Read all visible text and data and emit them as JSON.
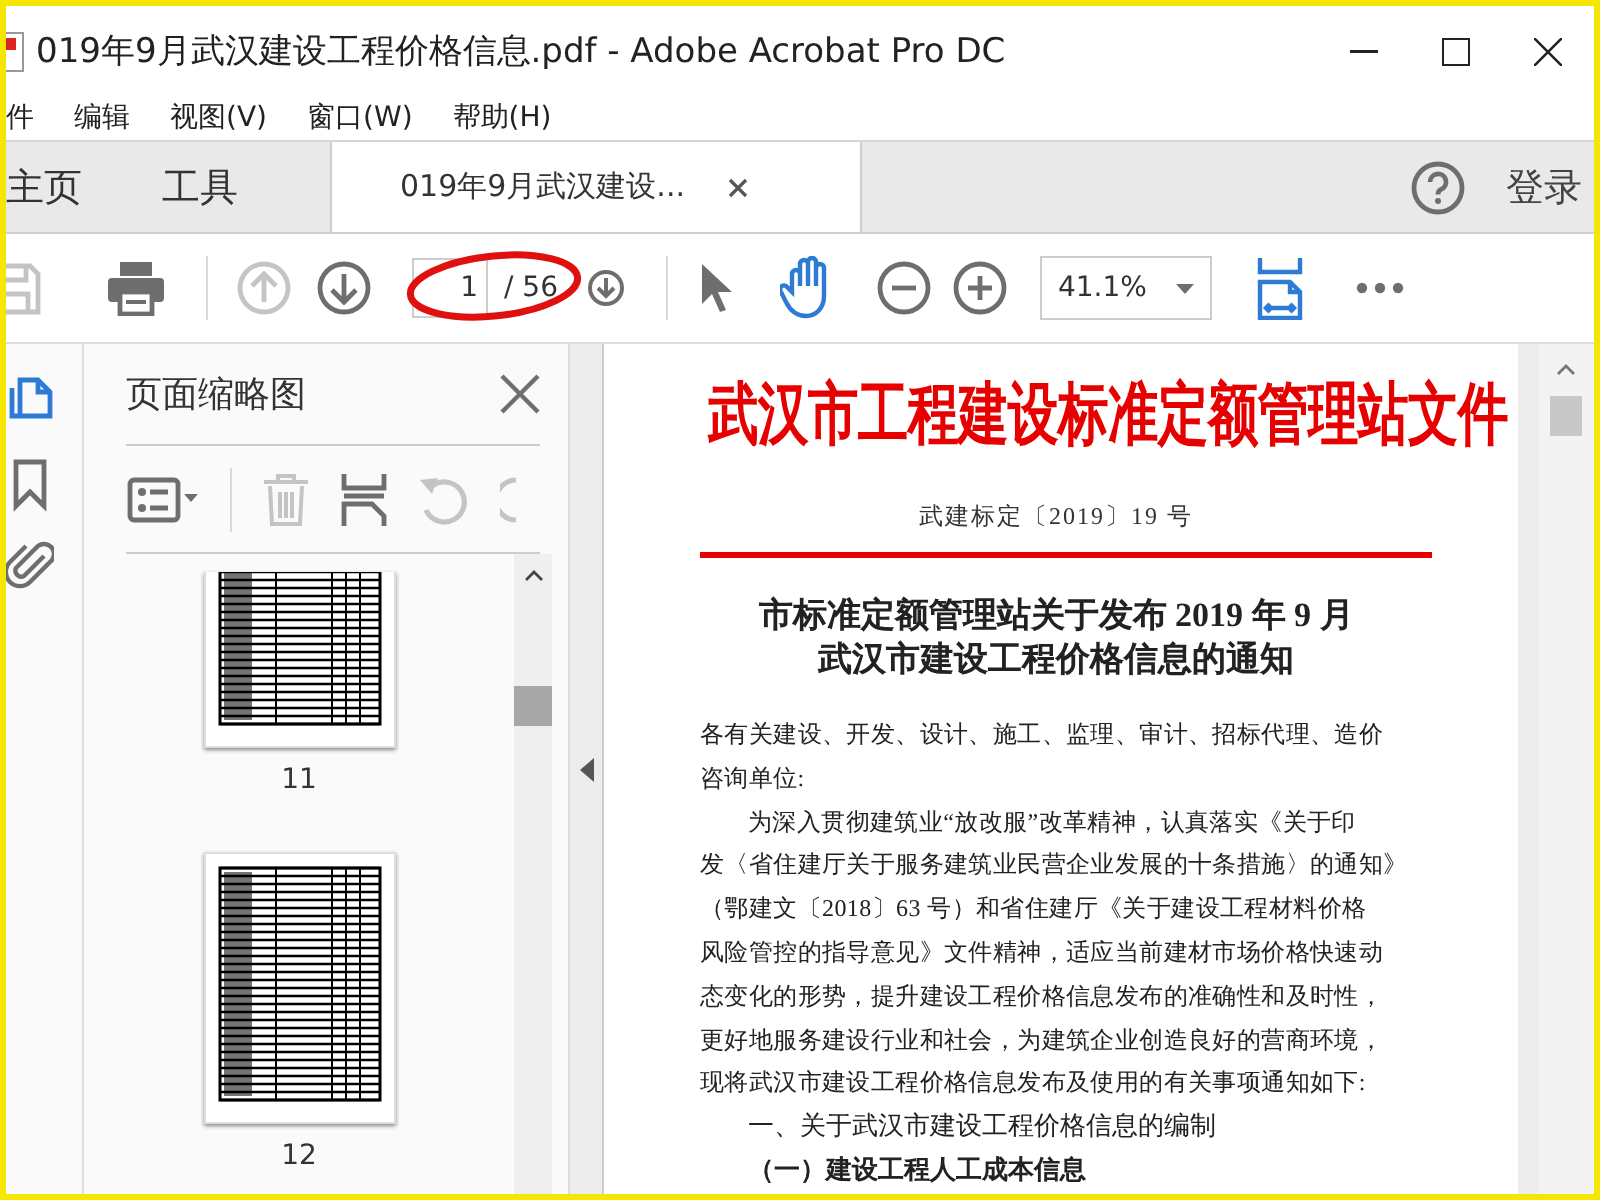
{
  "window": {
    "title": "019年9月武汉建设工程价格信息.pdf - Adobe Acrobat Pro DC"
  },
  "menu": [
    "件",
    "编辑",
    "视图(V)",
    "窗口(W)",
    "帮助(H)"
  ],
  "tabs": [
    {
      "label": "主页",
      "selected": false
    },
    {
      "label": "工具",
      "selected": false
    },
    {
      "label": "019年9月武汉建设...",
      "selected": true
    }
  ],
  "sign_in": "登录",
  "toolbar": {
    "tools": [
      {
        "kind": "save",
        "disabled": true
      },
      {
        "kind": "print",
        "disabled": false
      },
      {
        "kind": "prev",
        "disabled": true
      },
      {
        "kind": "next",
        "disabled": false
      }
    ],
    "page_number": "1",
    "page_total": "/ 56",
    "zoom": "41.1%"
  },
  "side_rail": [
    {
      "kind": "pages",
      "selected": true
    },
    {
      "kind": "bookmarks",
      "selected": false
    },
    {
      "kind": "attachments",
      "selected": false
    }
  ],
  "thumbnails_panel": {
    "title": "页面缩略图",
    "tools": [
      {
        "kind": "options",
        "disabled": false
      },
      {
        "kind": "delete",
        "disabled": true
      },
      {
        "kind": "insert",
        "disabled": false
      },
      {
        "kind": "rotate",
        "disabled": true
      }
    ],
    "pages": [
      {
        "label": "11"
      },
      {
        "label": "12"
      }
    ]
  },
  "document": {
    "header": "武汉市工程建设标准定额管理站文件",
    "doc_number": "武建标定〔2019〕19 号",
    "title_lines": [
      "市标准定额管理站关于发布 2019 年 9 月",
      "武汉市建设工程价格信息的通知"
    ],
    "paragraphs": [
      {
        "indent": false,
        "lines": [
          "各有关建设、开发、设计、施工、监理、审计、招标代理、造价",
          "咨询单位:"
        ]
      },
      {
        "indent": true,
        "lines": [
          "为深入贯彻建筑业“放改服”改革精神，认真落实《关于印",
          "发〈省住建厅关于服务建筑业民营企业发展的十条措施〉的通知》",
          "（鄂建文〔2018〕63 号）和省住建厅《关于建设工程材料价格",
          "风险管控的指导意见》文件精神，适应当前建材市场价格快速动",
          "态变化的形势，提升建设工程价格信息发布的准确性和及时性，",
          "更好地服务建设行业和社会，为建筑企业创造良好的营商环境，",
          "现将武汉市建设工程价格信息发布及使用的有关事项通知如下:"
        ]
      }
    ],
    "headings": [
      "一、关于武汉市建设工程价格信息的编制",
      "（一）建设工程人工成本信息"
    ]
  }
}
